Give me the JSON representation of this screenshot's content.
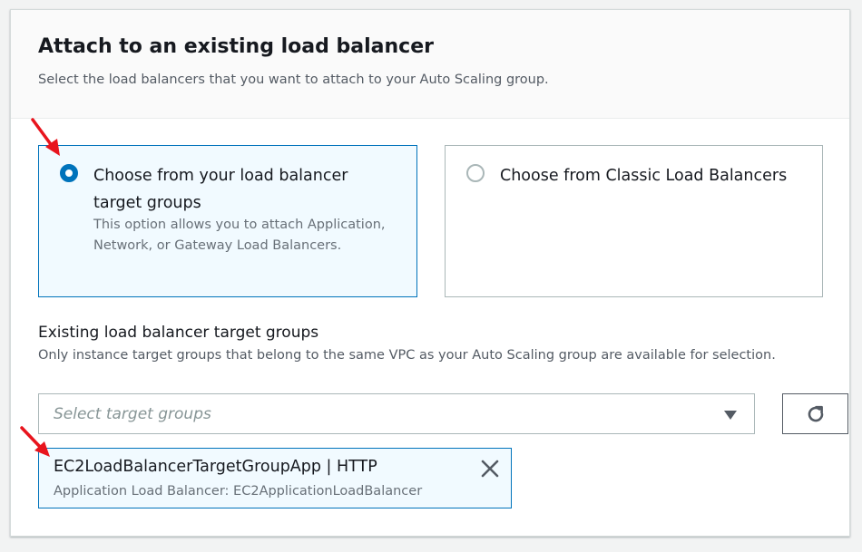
{
  "header": {
    "title": "Attach to an existing load balancer",
    "subtitle": "Select the load balancers that you want to attach to your Auto Scaling group."
  },
  "options": [
    {
      "label": "Choose from your load balancer target groups",
      "description": "This option allows you to attach Application, Network, or Gateway Load Balancers.",
      "selected": true
    },
    {
      "label": "Choose from Classic Load Balancers",
      "description": "",
      "selected": false
    }
  ],
  "target_groups": {
    "label": "Existing load balancer target groups",
    "description": "Only instance target groups that belong to the same VPC as your Auto Scaling group are available for selection.",
    "placeholder": "Select target groups",
    "selected_token": {
      "title": "EC2LoadBalancerTargetGroupApp | HTTP",
      "subtitle": "Application Load Balancer: EC2ApplicationLoadBalancer"
    }
  },
  "icons": {
    "refresh": "refresh-icon",
    "dismiss": "close-icon",
    "caret": "caret-down-icon",
    "annotation": "red-arrow-icon"
  },
  "colors": {
    "accent": "#0073bb",
    "selected_bg": "#f1faff",
    "annotation": "#e8141d"
  }
}
